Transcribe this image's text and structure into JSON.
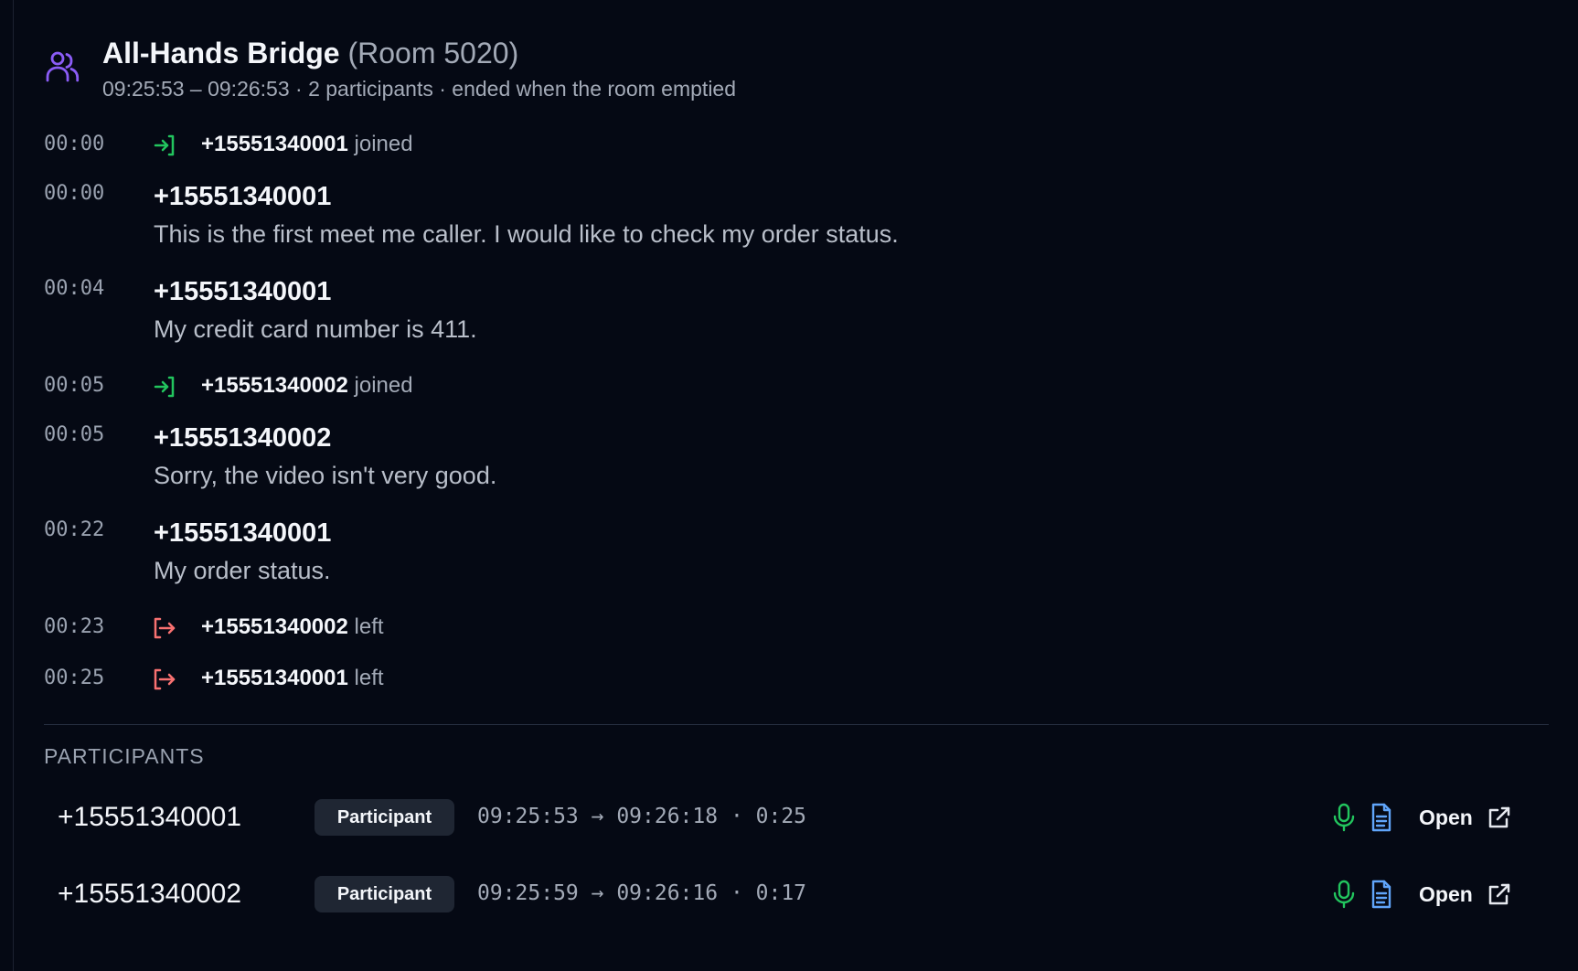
{
  "colors": {
    "background": "#050914",
    "header_icon": "#8b5cf6",
    "joined_icon": "#22c55e",
    "left_icon": "#f87171",
    "mic_icon": "#22c55e",
    "document_icon": "#60a5fa",
    "badge_background": "#1f2633"
  },
  "header": {
    "icon": "users-icon",
    "title": "All-Hands Bridge",
    "room": "(Room 5020)",
    "subtitle": "09:25:53 – 09:26:53 · 2 participants · ended when the room emptied"
  },
  "events": [
    {
      "time": "00:00",
      "icon": "login-icon",
      "phone": "+15551340001",
      "action": "joined"
    },
    {
      "time": "00:00",
      "speaker": "+15551340001",
      "message": "This is the first meet me caller. I would like to check my order status."
    },
    {
      "time": "00:04",
      "speaker": "+15551340001",
      "message": "My credit card number is 411."
    },
    {
      "time": "00:05",
      "icon": "login-icon",
      "phone": "+15551340002",
      "action": "joined"
    },
    {
      "time": "00:05",
      "speaker": "+15551340002",
      "message": "Sorry, the video isn't very good."
    },
    {
      "time": "00:22",
      "speaker": "+15551340001",
      "message": "My order status."
    },
    {
      "time": "00:23",
      "icon": "logout-icon",
      "phone": "+15551340002",
      "action": "left"
    },
    {
      "time": "00:25",
      "icon": "logout-icon",
      "phone": "+15551340001",
      "action": "left"
    }
  ],
  "participants_heading": "PARTICIPANTS",
  "participants": [
    {
      "phone": "+15551340001",
      "role": "Participant",
      "timing": "09:25:53 → 09:26:18 · 0:25",
      "recording_icon": "microphone-icon",
      "transcript_icon": "document-icon",
      "open_label": "Open",
      "open_icon": "external-link-icon"
    },
    {
      "phone": "+15551340002",
      "role": "Participant",
      "timing": "09:25:59 → 09:26:16 · 0:17",
      "recording_icon": "microphone-icon",
      "transcript_icon": "document-icon",
      "open_label": "Open",
      "open_icon": "external-link-icon"
    }
  ]
}
